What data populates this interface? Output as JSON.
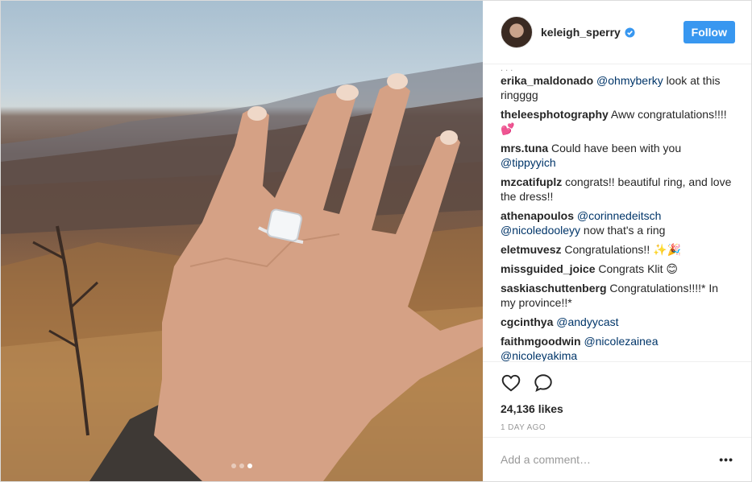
{
  "post": {
    "username": "keleigh_sperry",
    "follow_label": "Follow",
    "likes": "24,136 likes",
    "time": "1 day ago",
    "comment_placeholder": "Add a comment…",
    "more_label": "•••"
  },
  "media": {
    "slide_count": 3,
    "active_slide": 3
  },
  "comments": [
    {
      "user": "erika_maldonado",
      "mention": "@ohmyberky",
      "text": " look at this ringggg"
    },
    {
      "user": "theleesphotography",
      "mention": "",
      "text": "Aww congratulations!!!! 💕"
    },
    {
      "user": "mrs.tuna",
      "mention": "",
      "text": "Could have been with you ",
      "mention_after": "@tippyyich"
    },
    {
      "user": "mzcatifuplz",
      "mention": "",
      "text": "congrats!! beautiful ring, and love the dress!!"
    },
    {
      "user": "athenapoulos",
      "mention": "@corinnedeitsch",
      "mention2": "@nicoledooleyy",
      "text": " now that's a ring"
    },
    {
      "user": "eletmuvesz",
      "mention": "",
      "text": "Congratulations!! ✨🎉"
    },
    {
      "user": "missguided_joice",
      "mention": "",
      "text": "Congrats Klit 😊"
    },
    {
      "user": "saskiaschuttenberg",
      "mention": "",
      "text": "Congratulations!!!!* In my province!!*"
    },
    {
      "user": "cgcinthya",
      "mention": "@andyycast",
      "text": ""
    },
    {
      "user": "faithmgoodwin",
      "mention": "@nicolezainea",
      "mention2": "@nicoleyakima",
      "text": ""
    }
  ],
  "icons": {
    "like": "heart-icon",
    "comment": "speech-bubble-icon",
    "verified": "verified-badge-icon"
  },
  "colors": {
    "follow_button": "#3897f0",
    "mention": "#003569",
    "muted": "#999999"
  }
}
